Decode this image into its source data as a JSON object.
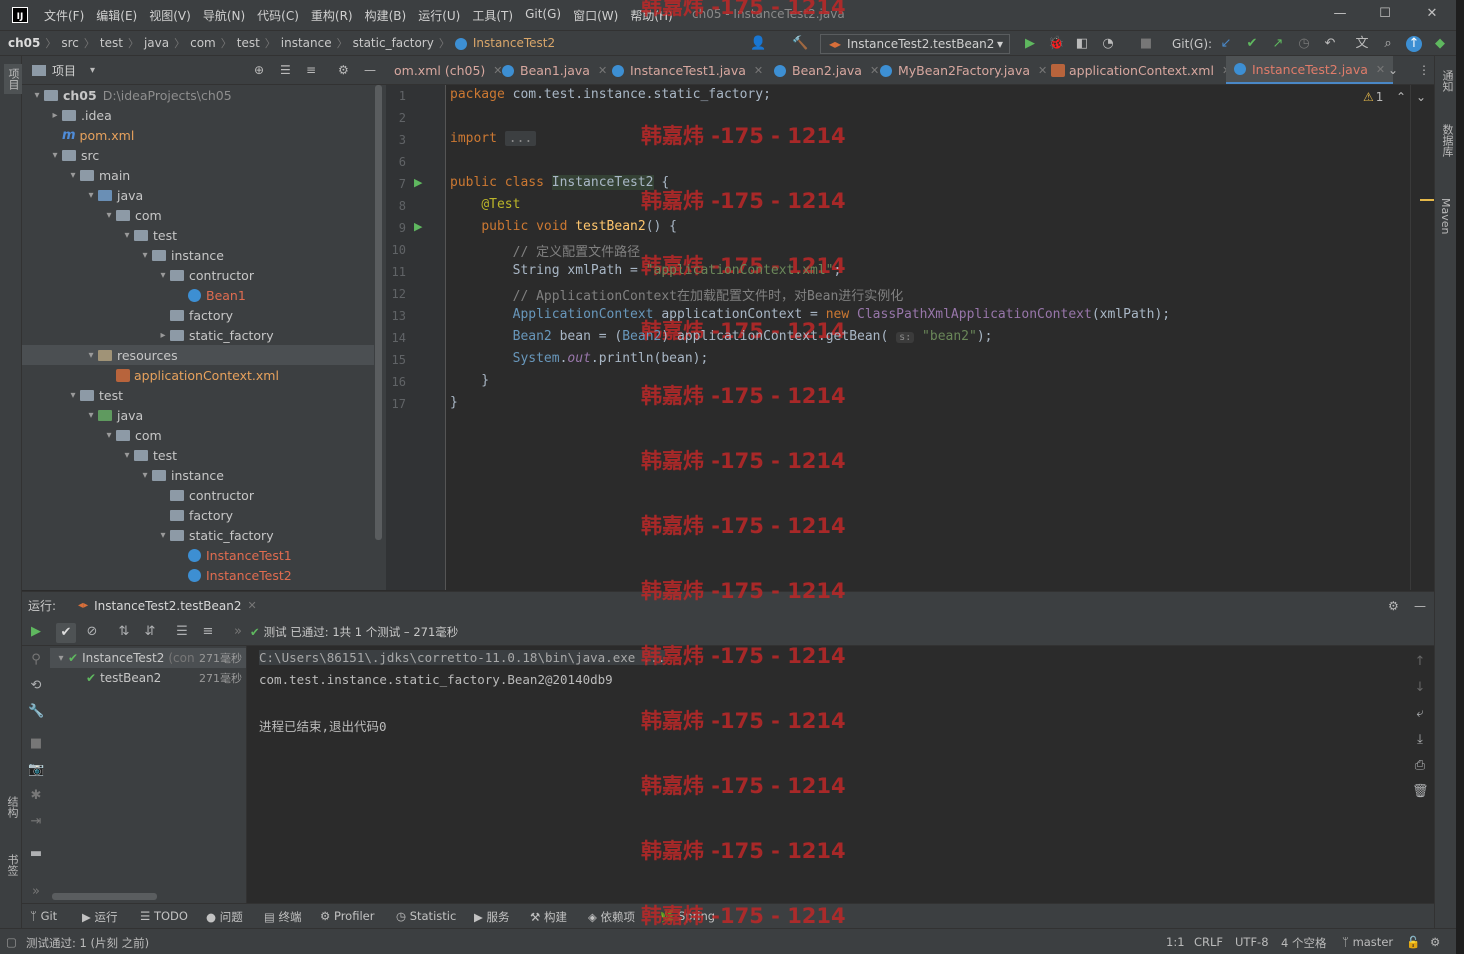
{
  "menu": [
    "文件(F)",
    "编辑(E)",
    "视图(V)",
    "导航(N)",
    "代码(C)",
    "重构(R)",
    "构建(B)",
    "运行(U)",
    "工具(T)",
    "Git(G)",
    "窗口(W)",
    "帮助(H)"
  ],
  "window_title": "ch05 - InstanceTest2.java",
  "breadcrumbs": [
    "ch05",
    "src",
    "test",
    "java",
    "com",
    "test",
    "instance",
    "static_factory",
    "InstanceTest2"
  ],
  "run_config": "InstanceTest2.testBean2",
  "git_label": "Git(G):",
  "project_panel": {
    "title": "项目"
  },
  "tree": [
    {
      "label": "ch05",
      "extra": "D:\\ideaProjects\\ch05",
      "indent": 0,
      "arrow": "▾",
      "type": "root"
    },
    {
      "label": ".idea",
      "indent": 1,
      "arrow": "▸",
      "type": "folder"
    },
    {
      "label": "pom.xml",
      "indent": 1,
      "arrow": "",
      "type": "maven"
    },
    {
      "label": "src",
      "indent": 1,
      "arrow": "▾",
      "type": "folder"
    },
    {
      "label": "main",
      "indent": 2,
      "arrow": "▾",
      "type": "folder"
    },
    {
      "label": "java",
      "indent": 3,
      "arrow": "▾",
      "type": "src"
    },
    {
      "label": "com",
      "indent": 4,
      "arrow": "▾",
      "type": "folder"
    },
    {
      "label": "test",
      "indent": 5,
      "arrow": "▾",
      "type": "folder"
    },
    {
      "label": "instance",
      "indent": 6,
      "arrow": "▾",
      "type": "folder"
    },
    {
      "label": "contructor",
      "indent": 7,
      "arrow": "▾",
      "type": "folder"
    },
    {
      "label": "Bean1",
      "indent": 8,
      "arrow": "",
      "type": "class"
    },
    {
      "label": "factory",
      "indent": 7,
      "arrow": "",
      "type": "folder"
    },
    {
      "label": "static_factory",
      "indent": 7,
      "arrow": "▸",
      "type": "folder"
    },
    {
      "label": "resources",
      "indent": 3,
      "arrow": "▾",
      "type": "res",
      "selected": true
    },
    {
      "label": "applicationContext.xml",
      "indent": 4,
      "arrow": "",
      "type": "xml"
    },
    {
      "label": "test",
      "indent": 2,
      "arrow": "▾",
      "type": "folder"
    },
    {
      "label": "java",
      "indent": 3,
      "arrow": "▾",
      "type": "test"
    },
    {
      "label": "com",
      "indent": 4,
      "arrow": "▾",
      "type": "folder"
    },
    {
      "label": "test",
      "indent": 5,
      "arrow": "▾",
      "type": "folder"
    },
    {
      "label": "instance",
      "indent": 6,
      "arrow": "▾",
      "type": "folder"
    },
    {
      "label": "contructor",
      "indent": 7,
      "arrow": "",
      "type": "folder"
    },
    {
      "label": "factory",
      "indent": 7,
      "arrow": "",
      "type": "folder"
    },
    {
      "label": "static_factory",
      "indent": 7,
      "arrow": "▾",
      "type": "folder"
    },
    {
      "label": "InstanceTest1",
      "indent": 8,
      "arrow": "",
      "type": "class"
    },
    {
      "label": "InstanceTest2",
      "indent": 8,
      "arrow": "",
      "type": "class"
    }
  ],
  "editor_tabs": [
    {
      "label": "om.xml (ch05)",
      "icon": "none"
    },
    {
      "label": "Bean1.java",
      "icon": "class"
    },
    {
      "label": "InstanceTest1.java",
      "icon": "class"
    },
    {
      "label": "Bean2.java",
      "icon": "class"
    },
    {
      "label": "MyBean2Factory.java",
      "icon": "class"
    },
    {
      "label": "applicationContext.xml",
      "icon": "xml"
    },
    {
      "label": "InstanceTest2.java",
      "icon": "class",
      "active": true
    }
  ],
  "warning_count": "1",
  "code_lines": [
    "<span class=\"kw\">package</span> com.test.instance.static_factory;",
    "",
    "<span class=\"kw\">import</span> <span class=\"import-fold\">...</span>",
    "",
    "<span class=\"kw\">public class</span> <span class=\"hl-cls\">InstanceTest2</span> {",
    "    <span class=\"ann\">@Test</span>",
    "    <span class=\"kw\">public void</span> <span class=\"fn\">testBean2</span>() {",
    "        <span class=\"cmt\">// 定义配置文件路径</span>",
    "        String xmlPath = <span class=\"str\">\"applicationContext.xml\"</span>;",
    "        <span class=\"cmt\">// ApplicationContext在加载配置文件时，对Bean进行实例化</span>",
    "        <span class=\"iface\">ApplicationContext</span> applicationContext = <span class=\"kw\">new</span> <span class=\"stat\" style=\"font-style:normal;color:#9876aa\">ClassPathXmlApplicationContext</span>(xmlPath);",
    "        <span class=\"iface\">Bean2</span> bean = (<span class=\"iface\">Bean2</span>) applicationContext.getBean( <span class=\"hint\">s:</span> <span class=\"str\">\"bean2\"</span>);",
    "        <span class=\"iface\">System</span>.<span class=\"stat\">out</span>.println(bean);",
    "    }",
    "}"
  ],
  "line_numbers": [
    "1",
    "2",
    "3",
    "6",
    "7",
    "8",
    "9",
    "10",
    "11",
    "12",
    "13",
    "14",
    "15",
    "16",
    "17"
  ],
  "run_panel": {
    "label": "运行:",
    "tab": "InstanceTest2.testBean2",
    "status": "测试 已通过: 1共 1 个测试 – 271毫秒",
    "tree": [
      {
        "label": "InstanceTest2",
        "extra": "(con",
        "time": "271毫秒",
        "indent": 0
      },
      {
        "label": "testBean2",
        "extra": "",
        "time": "271毫秒",
        "indent": 1
      }
    ],
    "console": [
      "C:\\Users\\86151\\.jdks\\corretto-11.0.18\\bin\\java.exe ...",
      "com.test.instance.static_factory.Bean2@20140db9",
      "",
      "进程已结束,退出代码0"
    ]
  },
  "bottom_tabs": [
    "Git",
    "运行",
    "TODO",
    "问题",
    "终端",
    "Profiler",
    "Statistic",
    "服务",
    "构建",
    "依赖项",
    "Spring"
  ],
  "status": {
    "message": "测试通过: 1 (片刻 之前)",
    "position": "1:1",
    "line_sep": "CRLF",
    "encoding": "UTF-8",
    "indent": "4 个空格",
    "branch": "master"
  },
  "side_labels": {
    "left_top": "项目",
    "left_struct": "结构",
    "left_bookmarks": "书签",
    "right_notif": "通知",
    "right_db": "数据库",
    "right_maven": "Maven"
  },
  "watermark": "韩嘉炜 -175 - 1214",
  "colors": {
    "accent": "#4a88c7",
    "pass": "#5fb85f",
    "watermark": "#be2828"
  }
}
